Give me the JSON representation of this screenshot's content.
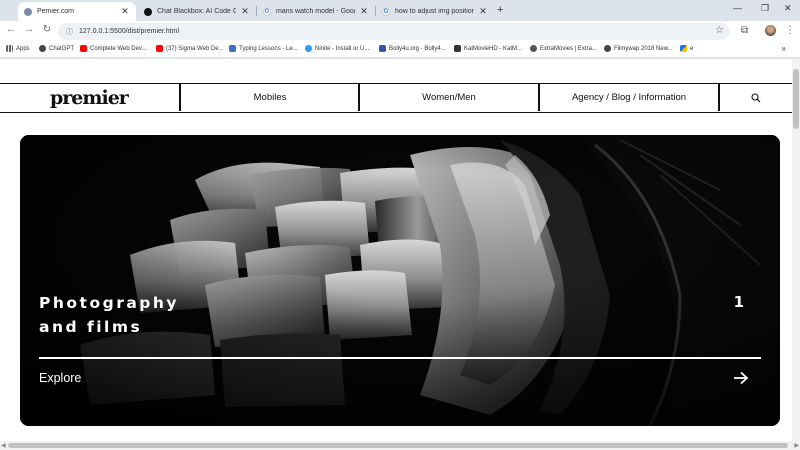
{
  "browser": {
    "tabs": [
      {
        "title": "Pemier.com",
        "active": true,
        "favicon": "globe-icon"
      },
      {
        "title": "Chat Blackbox: AI Code Generat",
        "active": false,
        "favicon": "blackbox-icon"
      },
      {
        "title": "mans watch model - Google Se",
        "active": false,
        "favicon": "google-icon"
      },
      {
        "title": "how to adjust img position in a",
        "active": false,
        "favicon": "google-icon"
      }
    ],
    "new_tab_glyph": "+",
    "url": "127.0.0.1:5500/dist/premier.html",
    "bookmarks": [
      {
        "label": "Apps",
        "icon": "apps-grid-icon",
        "color": "#5f6368"
      },
      {
        "label": "ChatGPT",
        "icon": "chatgpt-icon",
        "color": "#444444"
      },
      {
        "label": "Complete Web Dev...",
        "icon": "youtube-icon",
        "color": "#ff0000"
      },
      {
        "label": "(37) Sigma Web De...",
        "icon": "youtube-icon",
        "color": "#ff0000"
      },
      {
        "label": "Typing Lessons - Le...",
        "icon": "typing-icon",
        "color": "#3b6fd1"
      },
      {
        "label": "Ninite - Install or U...",
        "icon": "ninite-icon",
        "color": "#2a9df4"
      },
      {
        "label": "Bolly4u.org - Bolly4...",
        "icon": "bolly-icon",
        "color": "#3355aa"
      },
      {
        "label": "KatMovieHD - KatM...",
        "icon": "katmovie-icon",
        "color": "#333333"
      },
      {
        "label": "ExtraMovies | Extra...",
        "icon": "extramovies-icon",
        "color": "#555555"
      },
      {
        "label": "Filmywap 2018 New...",
        "icon": "filmywap-icon",
        "color": "#444444"
      },
      {
        "label": "e",
        "icon": "drive-icon",
        "color": "#1a73e8"
      }
    ],
    "bookmarks_more": "»"
  },
  "site": {
    "logo": "premier",
    "nav": [
      {
        "label": "Mobiles"
      },
      {
        "label": "Women/Men"
      },
      {
        "label": "Agency / Blog / Information"
      }
    ]
  },
  "hero": {
    "title_line1": "Photography",
    "title_line2": "and films",
    "index": "1",
    "cta": "Explore"
  },
  "colors": {
    "tabstrip": "#dde3ea",
    "ink": "#111111",
    "hero_bg": "#050505",
    "hero_text": "#ffffff"
  }
}
